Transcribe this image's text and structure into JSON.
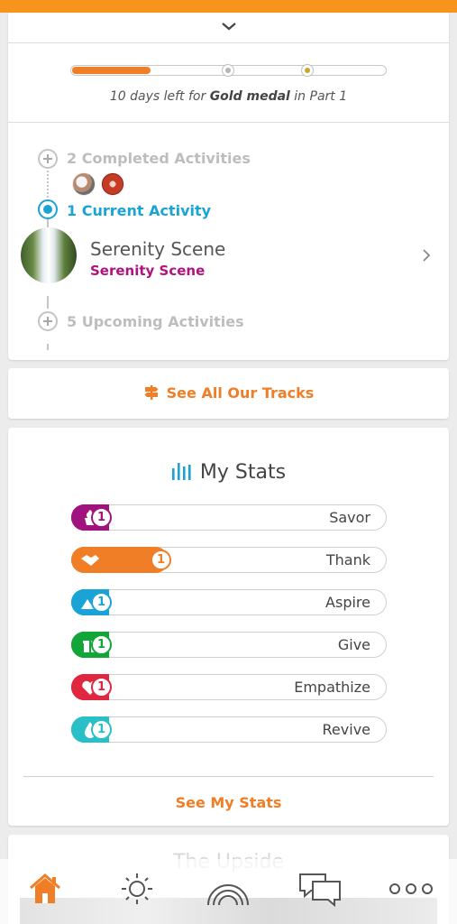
{
  "progress": {
    "value": 0.25,
    "text_prefix": "10 days left for ",
    "text_bold": "Gold medal",
    "text_suffix": " in Part 1"
  },
  "timeline": {
    "completed_label": "2 Completed Activities",
    "current_label": "1 Current Activity",
    "upcoming_label": "5 Upcoming Activities",
    "activity": {
      "title": "Serenity Scene",
      "subtitle": "Serenity Scene"
    }
  },
  "tracks": {
    "label": "See All Our Tracks"
  },
  "stats": {
    "title": "My Stats",
    "items": [
      {
        "label": "Savor",
        "count": "1",
        "color": "#a2127f",
        "fill": 0
      },
      {
        "label": "Thank",
        "count": "1",
        "color": "#f07e26",
        "fill": 1
      },
      {
        "label": "Aspire",
        "count": "1",
        "color": "#1aa3d6",
        "fill": 0
      },
      {
        "label": "Give",
        "count": "1",
        "color": "#12a538",
        "fill": 0
      },
      {
        "label": "Empathize",
        "count": "1",
        "color": "#e1263f",
        "fill": 0
      },
      {
        "label": "Revive",
        "count": "1",
        "color": "#28c0c6",
        "fill": 0
      }
    ],
    "see_label": "See My Stats"
  },
  "upside": {
    "title": "The Upside"
  },
  "colors": {
    "brand_orange": "#f07e26",
    "current_blue": "#1aa3d6",
    "magenta": "#b0137d"
  },
  "nav": {
    "items": [
      {
        "icon": "home-icon",
        "active": true
      },
      {
        "icon": "sun-icon",
        "active": false
      },
      {
        "icon": "rainbow-icon",
        "active": false
      },
      {
        "icon": "chat-icon",
        "active": false
      },
      {
        "icon": "more-icon",
        "active": false
      }
    ]
  }
}
